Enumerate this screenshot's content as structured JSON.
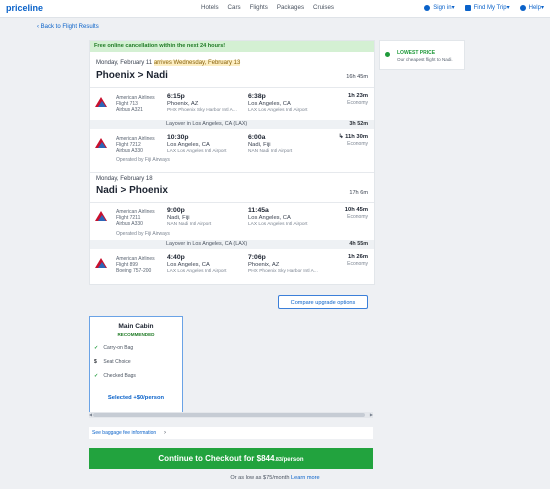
{
  "header": {
    "logo": "priceline",
    "nav": [
      "Hotels",
      "Cars",
      "Flights",
      "Packages",
      "Cruises"
    ],
    "signin": "Sign in",
    "mytrip": "Find My Trip",
    "help": "Help"
  },
  "back_link": "‹ Back to Flight Results",
  "promo": "Free online cancellation within the next 24 hours!",
  "outbound": {
    "date_prefix": "Monday, February 11",
    "arrives": "arrives Wednesday, February 13",
    "route": "Phoenix > Nadi",
    "total": "16h 45m",
    "segments": [
      {
        "airline": "American Airlines",
        "flight": "Flight 713",
        "aircraft": "Airbus A321",
        "dep_time": "6:15p",
        "dep_city": "Phoenix, AZ",
        "dep_apt": "PHX Phoenix Sky Harbor Intl A...",
        "arr_time": "6:38p",
        "arr_city": "Los Angeles, CA",
        "arr_apt": "LAX Los Angeles Intl Airport",
        "duration": "1h 23m",
        "cabin": "Economy"
      },
      {
        "airline": "American Airlines",
        "flight": "Flight 7212",
        "aircraft": "Airbus A330",
        "dep_time": "10:30p",
        "dep_city": "Los Angeles, CA",
        "dep_apt": "LAX Los Angeles Intl Airport",
        "arr_time": "6:00a",
        "arr_city": "Nadi, Fiji",
        "arr_apt": "NAN Nadi Intl Airport",
        "duration": "↳ 11h 30m",
        "cabin": "Economy",
        "operated": "Operated by Fiji Airways"
      }
    ],
    "layover": {
      "text": "Layover in Los Angeles, CA (LAX)",
      "duration": "3h 52m"
    }
  },
  "return": {
    "date": "Monday, February 18",
    "route": "Nadi > Phoenix",
    "total": "17h 6m",
    "segments": [
      {
        "airline": "American Airlines",
        "flight": "Flight 7211",
        "aircraft": "Airbus A330",
        "dep_time": "9:00p",
        "dep_city": "Nadi, Fiji",
        "dep_apt": "NAN Nadi Intl Airport",
        "arr_time": "11:45a",
        "arr_city": "Los Angeles, CA",
        "arr_apt": "LAX Los Angeles Intl Airport",
        "duration": "10h 45m",
        "cabin": "Economy",
        "operated": "Operated by Fiji Airways"
      },
      {
        "airline": "American Airlines",
        "flight": "Flight 899",
        "aircraft": "Boeing 757-200",
        "dep_time": "4:40p",
        "dep_city": "Los Angeles, CA",
        "dep_apt": "LAX Los Angeles Intl Airport",
        "arr_time": "7:06p",
        "arr_city": "Phoenix, AZ",
        "arr_apt": "PHX Phoenix Sky Harbor Intl A...",
        "duration": "1h 26m",
        "cabin": "Economy"
      }
    ],
    "layover": {
      "text": "Layover in Los Angeles, CA (LAX)",
      "duration": "4h 55m"
    }
  },
  "sidebar": {
    "title": "LOWEST PRICE",
    "sub": "Our cheapest flight to Nadi."
  },
  "compare_button": "Compare upgrade options",
  "cabin_card": {
    "title": "Main Cabin",
    "badge": "RECOMMENDED",
    "features": [
      {
        "mark": "✓",
        "label": "Carry-on Bag"
      },
      {
        "mark": "$",
        "label": "Seat Choice"
      },
      {
        "mark": "✓",
        "label": "Checked Bags"
      }
    ],
    "selected": "Selected +$0/person"
  },
  "baggage_link": "See baggage fee information",
  "checkout": {
    "label": "Continue to Checkout for $844",
    "cents": ".83",
    "per": "/person"
  },
  "afford": {
    "text": "Or as low as $75/month",
    "link": "Learn more"
  },
  "colors": {
    "brand": "#0a62c9",
    "checkout_green": "#22a33e",
    "promo_bg": "#d4f0d3"
  }
}
